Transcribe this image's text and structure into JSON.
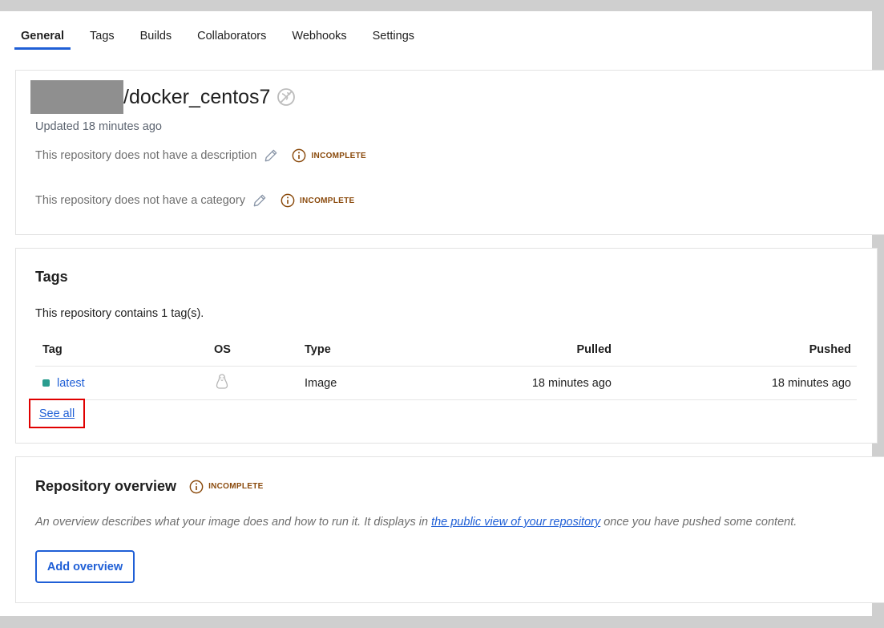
{
  "tabs": [
    {
      "label": "General"
    },
    {
      "label": "Tags"
    },
    {
      "label": "Builds"
    },
    {
      "label": "Collaborators"
    },
    {
      "label": "Webhooks"
    },
    {
      "label": "Settings"
    }
  ],
  "active_tab": "General",
  "repo": {
    "name": "/docker_centos7",
    "visibility_icon": "globe-slash-icon",
    "updated": "Updated 18 minutes ago",
    "description_text": "This repository does not have a description",
    "category_text": "This repository does not have a category",
    "incomplete_label": "INCOMPLETE"
  },
  "tags": {
    "title": "Tags",
    "count_text": "This repository contains 1 tag(s).",
    "headers": {
      "tag": "Tag",
      "os": "OS",
      "type": "Type",
      "pulled": "Pulled",
      "pushed": "Pushed"
    },
    "rows": [
      {
        "tag": "latest",
        "os_icon": "linux-icon",
        "type": "Image",
        "pulled": "18 minutes ago",
        "pushed": "18 minutes ago"
      }
    ],
    "see_all": "See all"
  },
  "overview": {
    "title": "Repository overview",
    "incomplete_label": "INCOMPLETE",
    "desc_before": "An overview describes what your image does and how to run it. It displays in ",
    "desc_link": "the public view of your repository",
    "desc_after": " once you have pushed some content.",
    "add_button": "Add overview"
  },
  "colors": {
    "accent": "#1f5fd6",
    "incomplete": "#8a4a0c",
    "status_dot": "#2a9d8f",
    "highlight": "#e00000"
  }
}
